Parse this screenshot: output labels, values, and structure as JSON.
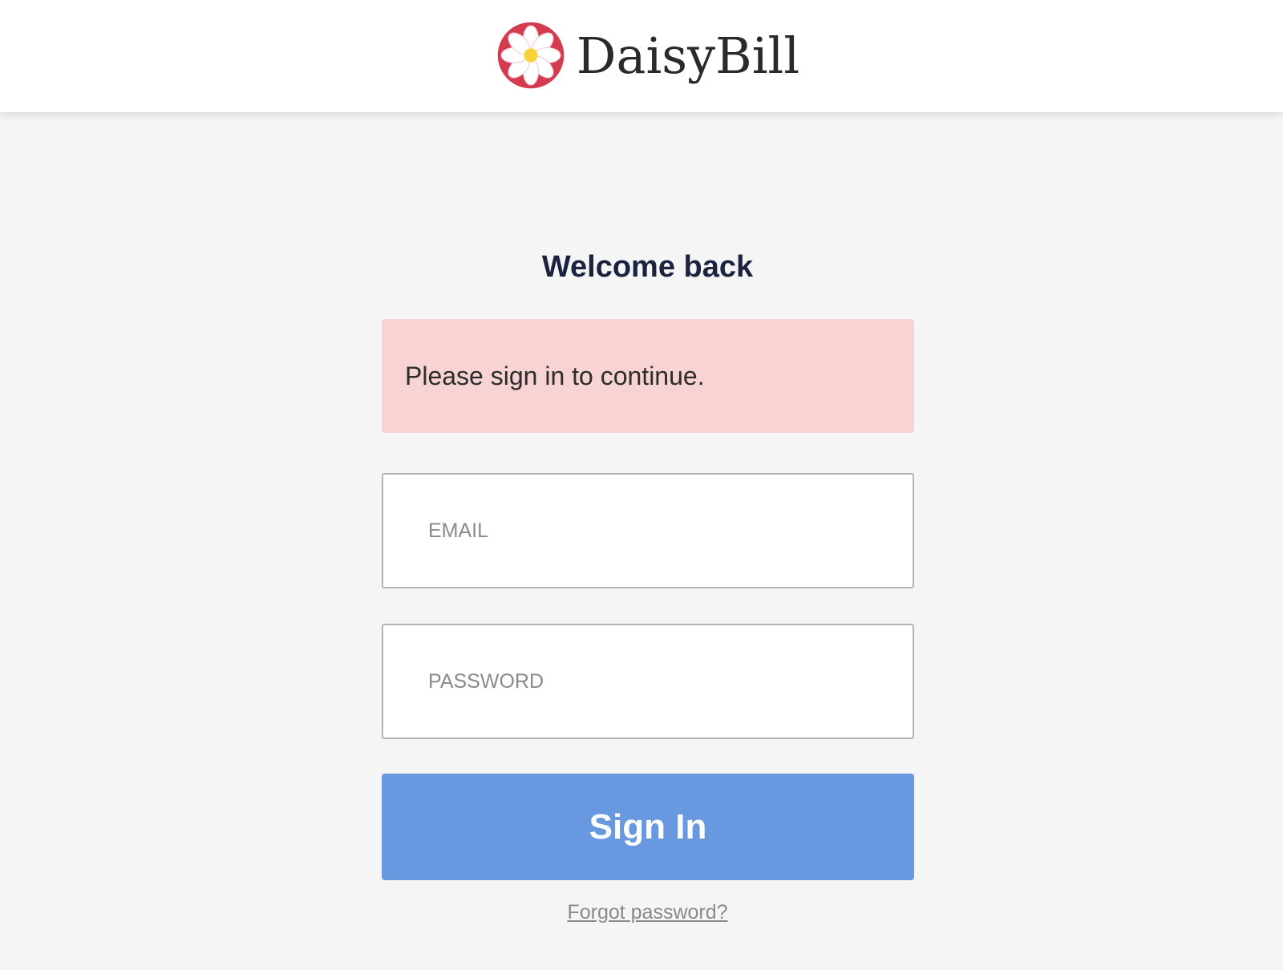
{
  "brand": {
    "logo_icon": "daisy-flower-logo",
    "name": "DaisyBill",
    "logo_ring_color": "#d53b4f",
    "logo_center_color": "#f6d33a"
  },
  "login": {
    "title": "Welcome back",
    "alert_message": "Please sign in to continue.",
    "email_placeholder": "EMAIL",
    "email_value": "",
    "password_placeholder": "PASSWORD",
    "password_value": "",
    "submit_label": "Sign In",
    "forgot_link": "Forgot password?"
  },
  "colors": {
    "alert_background": "#f7d4d3",
    "button_background": "#6898e0",
    "page_background": "#f5f5f5",
    "title_color": "#1c2340"
  }
}
